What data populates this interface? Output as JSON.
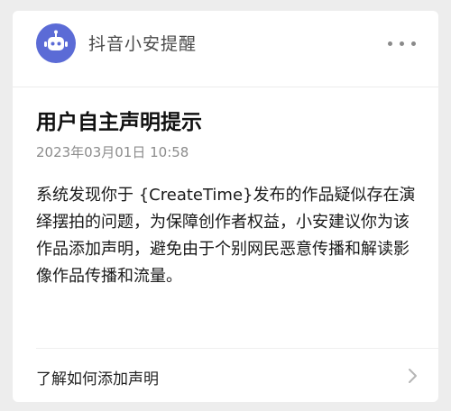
{
  "header": {
    "sender_name": "抖音小安提醒",
    "avatar_color": "#5b6bd6"
  },
  "message": {
    "title": "用户自主声明提示",
    "timestamp": "2023年03月01日  10:58",
    "body": "系统发现你于 {CreateTime}发布的作品疑似存在演绎摆拍的问题，为保障创作者权益，小安建议你为该作品添加声明，避免由于个别网民恶意传播和解读影像作品传播和流量。"
  },
  "footer": {
    "link_label": "了解如何添加声明"
  },
  "icons": {
    "avatar": "robot-icon",
    "more": "more-icon",
    "chevron": "chevron-right-icon"
  }
}
